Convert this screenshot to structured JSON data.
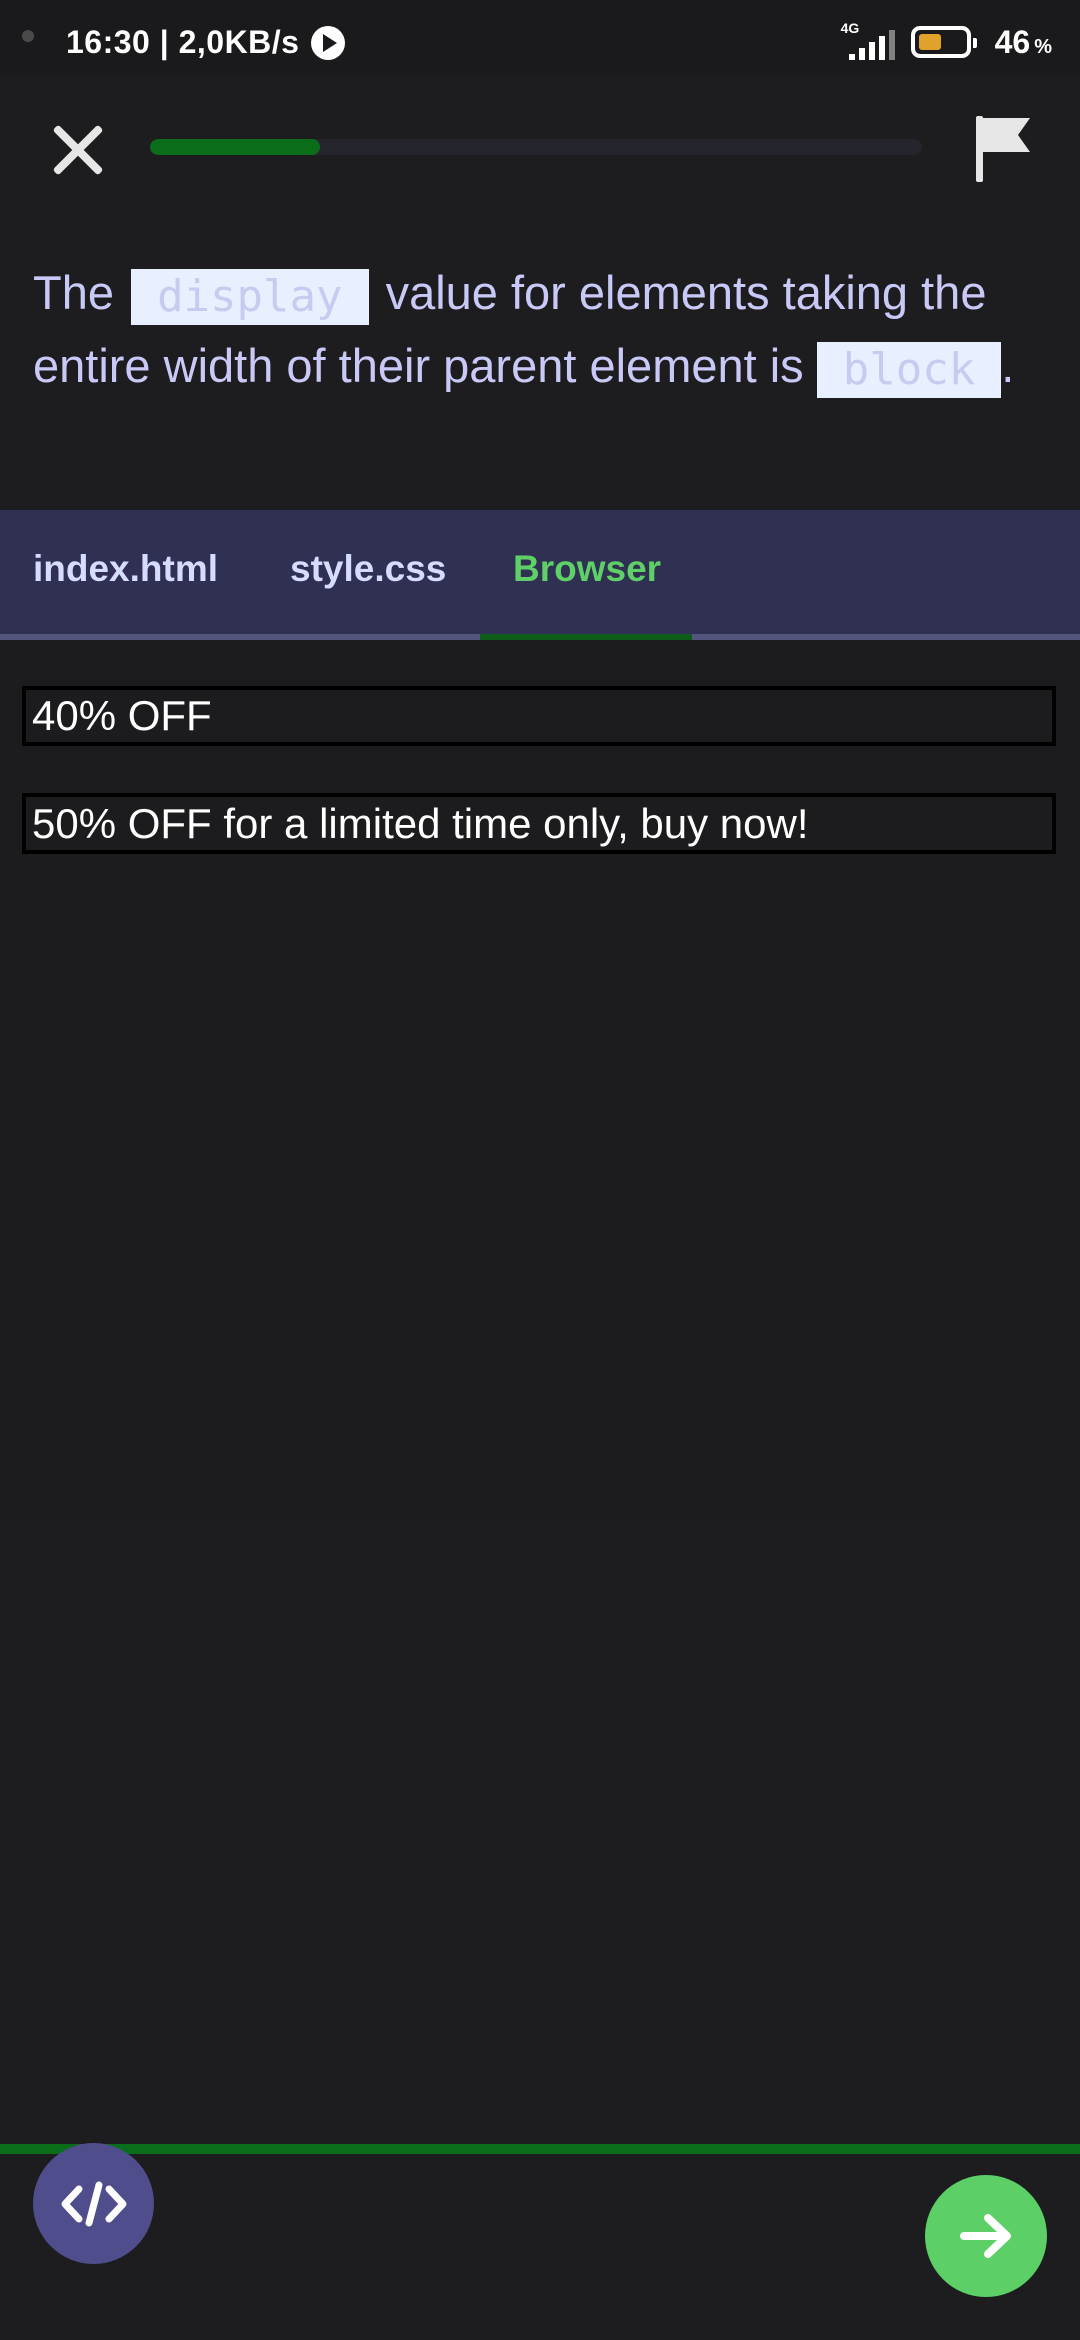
{
  "status_bar": {
    "time_speed": "16:30 | 2,0KB/s",
    "network_type": "4G",
    "battery_percent": "46",
    "battery_unit": "%",
    "battery_level": 0.46,
    "battery_color": "#e0a22a",
    "icons": [
      "play-icon",
      "signal-icon",
      "battery-icon"
    ]
  },
  "toolbar": {
    "close_icon": "close-icon",
    "flag_icon": "flag-icon",
    "progress": 0.22,
    "progress_color": "#0a6d1a"
  },
  "question": {
    "part1": "The",
    "code1": "display",
    "part2": "value for elements taking the entire width of their parent element is",
    "code2": "block",
    "part3": "."
  },
  "tabs": [
    {
      "label": "index.html",
      "active": false
    },
    {
      "label": "style.css",
      "active": false
    },
    {
      "label": "Browser",
      "active": true
    }
  ],
  "browser": {
    "lines": [
      "40% OFF",
      "50% OFF for a limited time only, buy now!"
    ]
  },
  "bottom": {
    "code_icon": "code-icon",
    "next_icon": "arrow-right-icon",
    "accent": "#5cd067"
  }
}
